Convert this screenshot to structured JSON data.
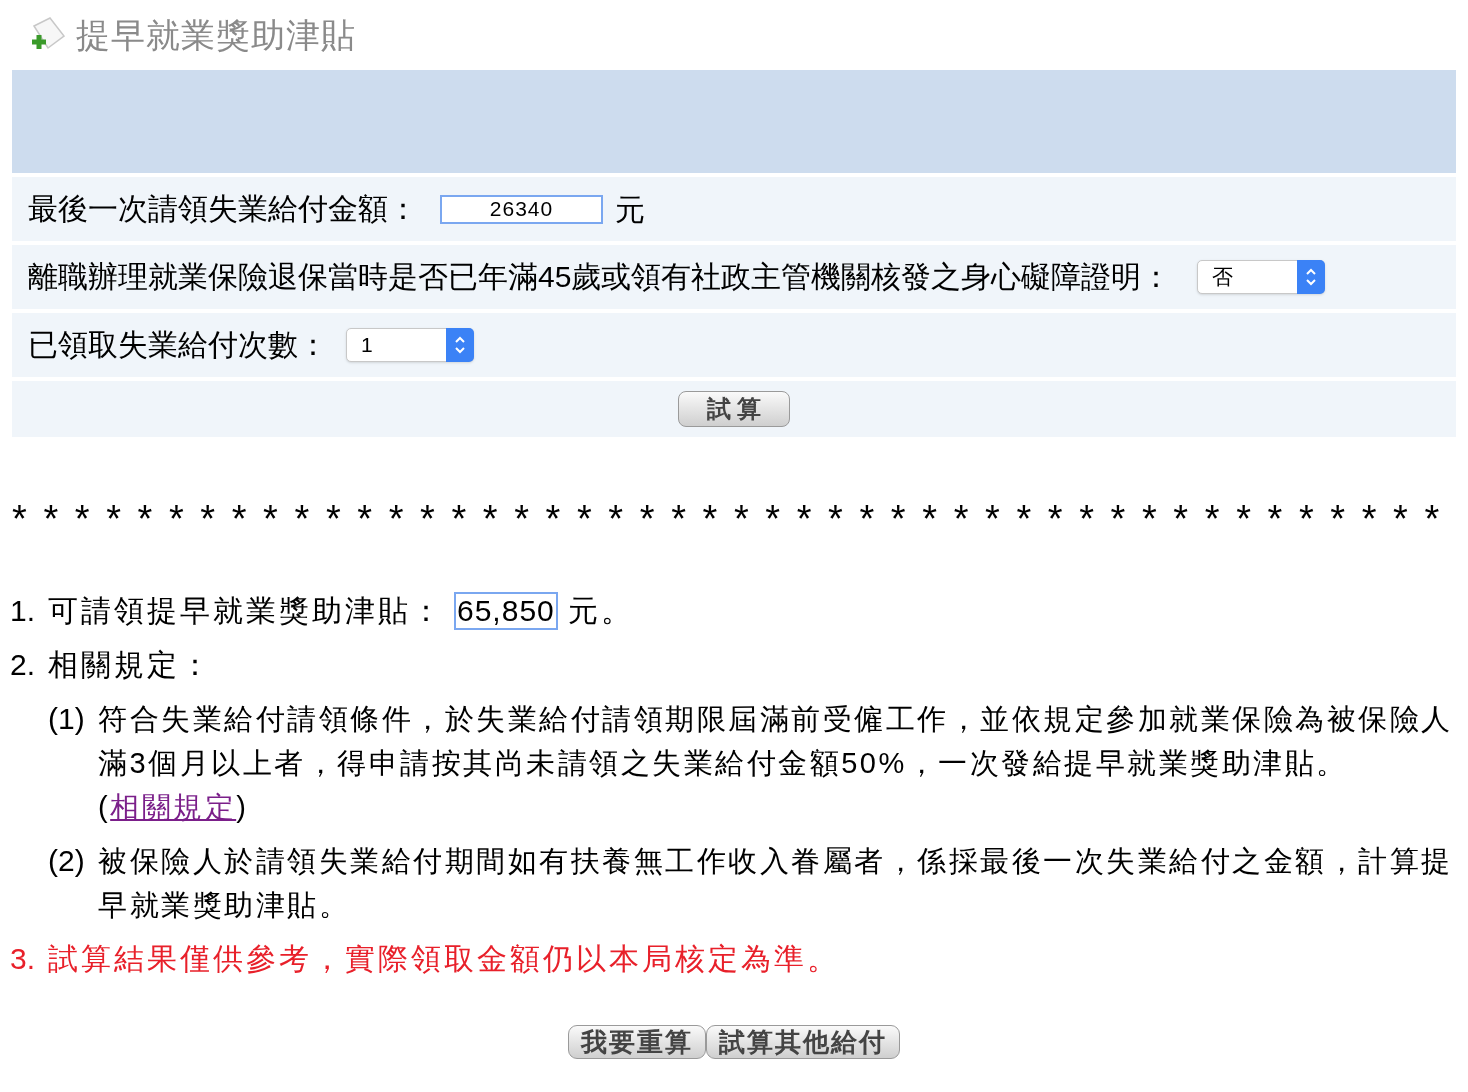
{
  "title": "提早就業獎助津貼",
  "form": {
    "rows": [
      {
        "kind": "input",
        "label": "最後一次請領失業給付金額：",
        "value": "26340",
        "unit": "元"
      },
      {
        "kind": "select",
        "label": "離職辦理就業保險退保當時是否已年滿45歲或領有社政主管機關核發之身心礙障證明：",
        "value": "否"
      },
      {
        "kind": "select",
        "label": "已領取失業給付次數：",
        "value": "1"
      }
    ],
    "submit_button": "試 算"
  },
  "divider": "**********************************************",
  "results": [
    {
      "kind": "amount",
      "number": "1.",
      "label": "可請領提早就業獎助津貼：",
      "amount": "65,850",
      "unit": "元。"
    },
    {
      "kind": "rules",
      "number": "2.",
      "label": "相關規定：",
      "children": [
        {
          "number": "(1)",
          "text": "符合失業給付請領條件，於失業給付請領期限屆滿前受僱工作，並依規定參加就業保險為被保險人滿3個月以上者，得申請按其尚未請領之失業給付金額50%，一次發給提早就業獎助津貼。 (",
          "link": "相關規定",
          "text_after": ")"
        },
        {
          "number": "(2)",
          "text": "被保險人於請領失業給付期間如有扶養無工作收入眷屬者，係採最後一次失業給付之金額，計算提早就業獎助津貼。"
        }
      ]
    },
    {
      "kind": "notice",
      "number": "3.",
      "text": "試算結果僅供參考，實際領取金額仍以本局核定為準。"
    }
  ],
  "buttons": [
    "我要重算",
    "試算其他給付"
  ]
}
